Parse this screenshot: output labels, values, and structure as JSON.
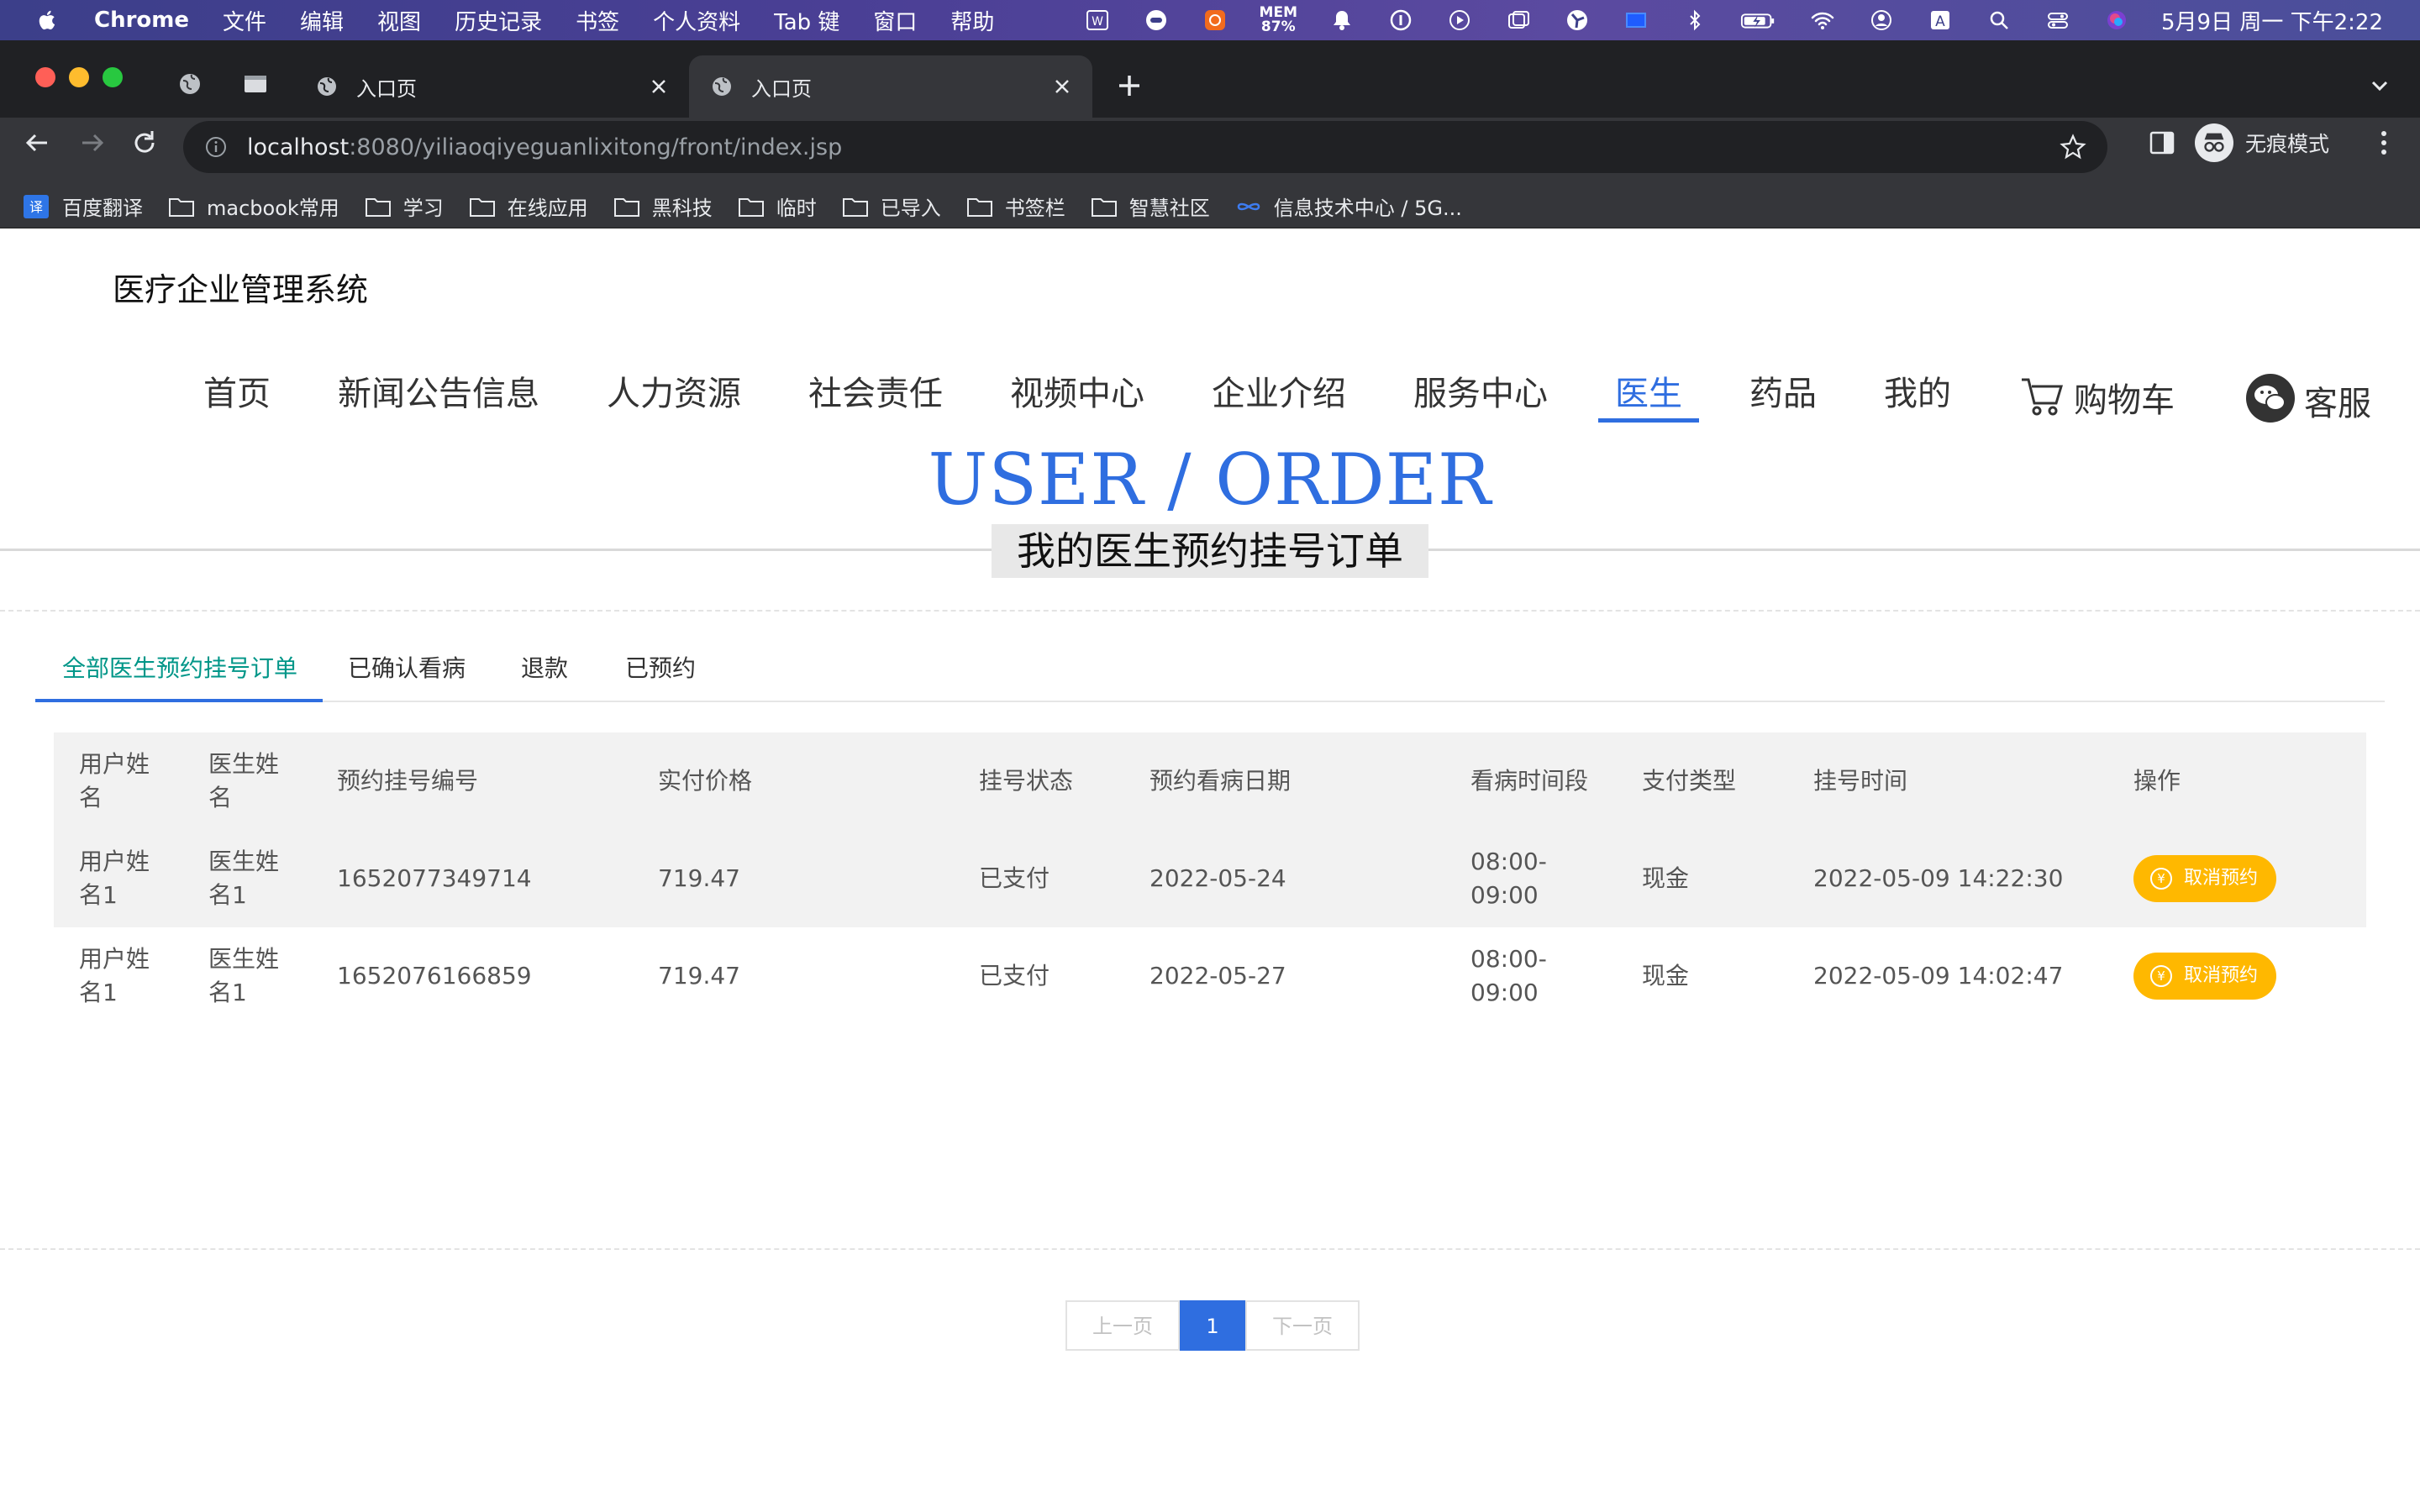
{
  "menubar": {
    "app_name": "Chrome",
    "items": [
      "文件",
      "编辑",
      "视图",
      "历史记录",
      "书签",
      "个人资料",
      "Tab 键",
      "窗口",
      "帮助"
    ],
    "mem_label": "MEM",
    "mem_value": "87%",
    "clock": "5月9日 周一 下午2:22"
  },
  "browser": {
    "tabs": [
      {
        "title": "入口页",
        "active": false
      },
      {
        "title": "入口页",
        "active": true
      }
    ],
    "url_host": "localhost",
    "url_path": ":8080/yiliaoqiyeguanlixitong/front/index.jsp",
    "incognito_label": "无痕模式",
    "bookmarks": [
      "百度翻译",
      "macbook常用",
      "学习",
      "在线应用",
      "黑科技",
      "临时",
      "已导入",
      "书签栏",
      "智慧社区",
      "信息技术中心 / 5G..."
    ]
  },
  "site": {
    "title": "医疗企业管理系统",
    "nav": [
      "首页",
      "新闻公告信息",
      "人力资源",
      "社会责任",
      "视频中心",
      "企业介绍",
      "服务中心",
      "医生",
      "药品",
      "我的",
      "购物车",
      "客服"
    ],
    "active_nav": "医生"
  },
  "hero": {
    "title": "USER / ORDER",
    "subtitle": "我的医生预约挂号订单"
  },
  "order_tabs": [
    "全部医生预约挂号订单",
    "已确认看病",
    "退款",
    "已预约"
  ],
  "table": {
    "headers": [
      "用户姓名",
      "医生姓名",
      "预约挂号编号",
      "实付价格",
      "挂号状态",
      "预约看病日期",
      "看病时间段",
      "支付类型",
      "挂号时间",
      "操作"
    ],
    "rows": [
      {
        "user": "用户姓名1",
        "doctor": "医生姓名1",
        "order_no": "1652077349714",
        "price": "719.47",
        "status": "已支付",
        "date": "2022-05-24",
        "time_slot": "08:00-09:00",
        "pay_type": "现金",
        "created": "2022-05-09 14:22:30",
        "action": "取消预约"
      },
      {
        "user": "用户姓名1",
        "doctor": "医生姓名1",
        "order_no": "1652076166859",
        "price": "719.47",
        "status": "已支付",
        "date": "2022-05-27",
        "time_slot": "08:00-09:00",
        "pay_type": "现金",
        "created": "2022-05-09 14:02:47",
        "action": "取消预约"
      }
    ]
  },
  "pager": {
    "prev": "上一页",
    "current": "1",
    "next": "下一页"
  },
  "colors": {
    "accent": "#2f6ee0",
    "tab_active_text": "#009688",
    "cancel_button": "#ffb800"
  }
}
